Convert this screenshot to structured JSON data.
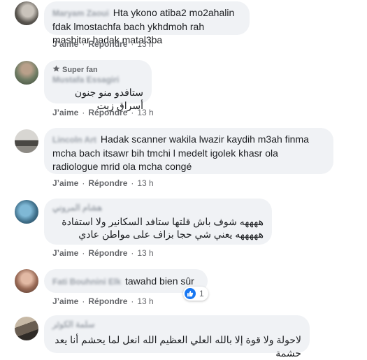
{
  "actions": {
    "like": "J’aime",
    "reply": "Répondre",
    "dot": "·"
  },
  "comments": [
    {
      "author": "Maryam Zaoui",
      "text": "Hta ykono atiba2 mo2ahalin fdak lmostachfa bach ykhdmoh rah masbitar hadak matal3ba",
      "time": "13 h"
    },
    {
      "badge": "Super fan",
      "author": "Mustafa Essagiri",
      "text": "ستافدو منو جنون أسراق زيت",
      "time": "13 h"
    },
    {
      "author": "Lincoln Art",
      "text": "Hadak scanner wakila lwazir kaydih m3ah finma mcha bach itsawr bih tmchi l medelt igolek khasr ola radiologue mrid ola mcha congé",
      "time": "13 h"
    },
    {
      "author": "هشام المروني",
      "text": "ههههه شوف باش قلتها ستافد السكانير ولا استفادة هههههه يعني شي حجا بزاف على مواطن عادي",
      "time": "13 h"
    },
    {
      "author": "Fati Bouhnini Elk",
      "text": "tawahd bien sûr",
      "time": "13 h",
      "reaction_count": "1"
    },
    {
      "author": "سلمة الكوثر",
      "text": "لاحولة ولا قوة إلا بالله العلي العظيم الله انعل لما يحشم أنا يعد حشمة"
    }
  ]
}
